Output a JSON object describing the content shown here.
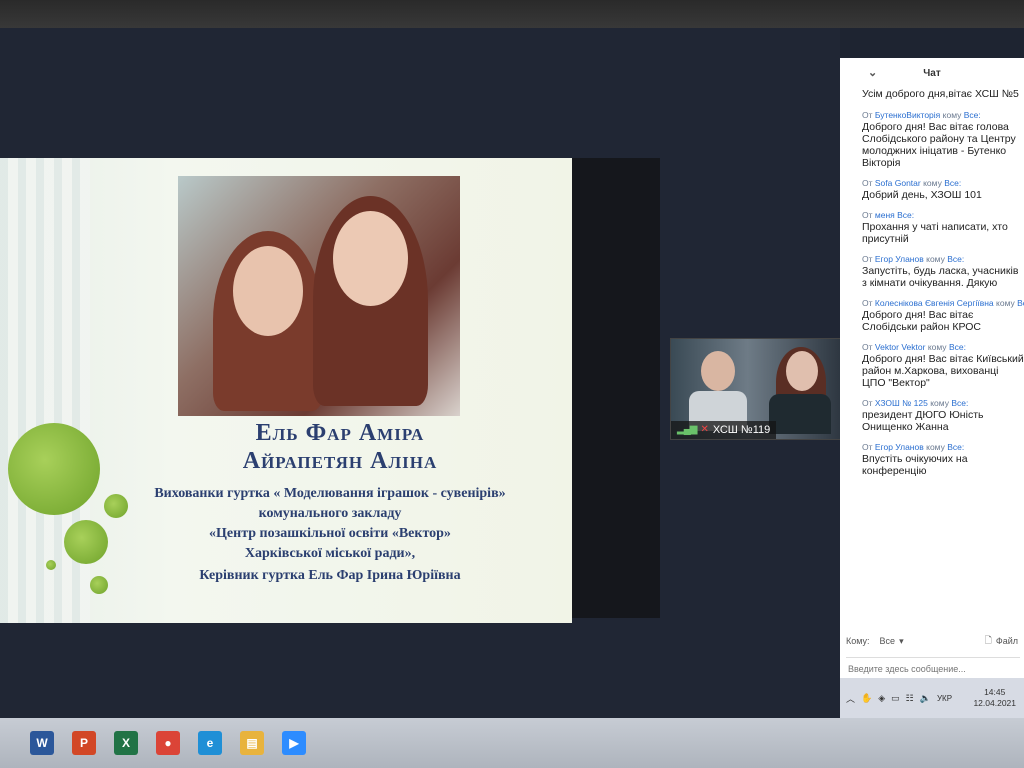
{
  "slide": {
    "title_line1": "Ель Фар Аміра",
    "title_line2": "Айрапетян Аліна",
    "line1": "Вихованки гуртка « Моделювання іграшок - сувенірів»",
    "line2": "комунального закладу",
    "line3": "«Центр позашкільної освіти «Вектор»",
    "line4": "Харківської міської ради»,",
    "line5": "Керівник гуртка Ель Фар Ірина Юріївна"
  },
  "video": {
    "label": "ХСШ №119"
  },
  "chat": {
    "title": "Чат",
    "first_message": "Усім доброго дня,вітає ХСШ №5",
    "messages": [
      {
        "prefix": "От",
        "sender": "БутенкоВикторія",
        "to_word": "кому",
        "recipient": "Все:",
        "text": "Доброго дня! Вас вітає голова Слобідського району та Центру молоджних ініцатив - Бутенко Вікторія"
      },
      {
        "prefix": "От",
        "sender": "Sofa Gontar",
        "to_word": "кому",
        "recipient": "Все:",
        "text": "Добрий день, ХЗОШ 101"
      },
      {
        "prefix": "От",
        "sender": "меня",
        "to_word": "",
        "recipient": "Все:",
        "text": "Прохання у чаті написати, хто присутній"
      },
      {
        "prefix": "От",
        "sender": "Егор Уланов",
        "to_word": "кому",
        "recipient": "Все:",
        "text": "Запустіть, будь ласка, учасників з кімнати очікування. Дякую"
      },
      {
        "prefix": "От",
        "sender": "Колеснікова Євгенія Сергіївна",
        "to_word": "кому",
        "recipient": "Все:",
        "text": "Доброго дня! Вас вітає  Слобідськи район КРОС"
      },
      {
        "prefix": "От",
        "sender": "Vektor Vektor",
        "to_word": "кому",
        "recipient": "Все:",
        "text": "Доброго дня! Вас вітає Київський район м.Харкова, вихованці ЦПО \"Вектор\""
      },
      {
        "prefix": "От",
        "sender": "ХЗОШ № 125",
        "to_word": "кому",
        "recipient": "Все:",
        "text": "президент ДЮГО Юність Онищенко Жанна"
      },
      {
        "prefix": "От",
        "sender": "Егор Уланов",
        "to_word": "кому",
        "recipient": "Все:",
        "text": "Впустіть очікуючих на конференцію"
      }
    ],
    "to_label": "Кому:",
    "to_value": "Все",
    "file_label": "Файл",
    "input_placeholder": "Введите здесь сообщение..."
  },
  "tray": {
    "lang": "УКР",
    "time": "14:45",
    "date": "12.04.2021"
  },
  "icons": {
    "chevron": "chevron-down-icon",
    "file": "file-icon",
    "signal": "signal-icon",
    "mic_muted": "mic-muted-icon"
  },
  "taskbar": {
    "apps": [
      {
        "name": "word",
        "glyph": "W",
        "color": "#2b579a"
      },
      {
        "name": "powerpoint",
        "glyph": "P",
        "color": "#d24726"
      },
      {
        "name": "excel",
        "glyph": "X",
        "color": "#217346"
      },
      {
        "name": "chrome",
        "glyph": "●",
        "color": "#db4437"
      },
      {
        "name": "edge",
        "glyph": "e",
        "color": "#1f8fd6"
      },
      {
        "name": "explorer",
        "glyph": "▤",
        "color": "#e8b33d"
      },
      {
        "name": "zoom",
        "glyph": "▶",
        "color": "#2d8cff"
      }
    ]
  }
}
